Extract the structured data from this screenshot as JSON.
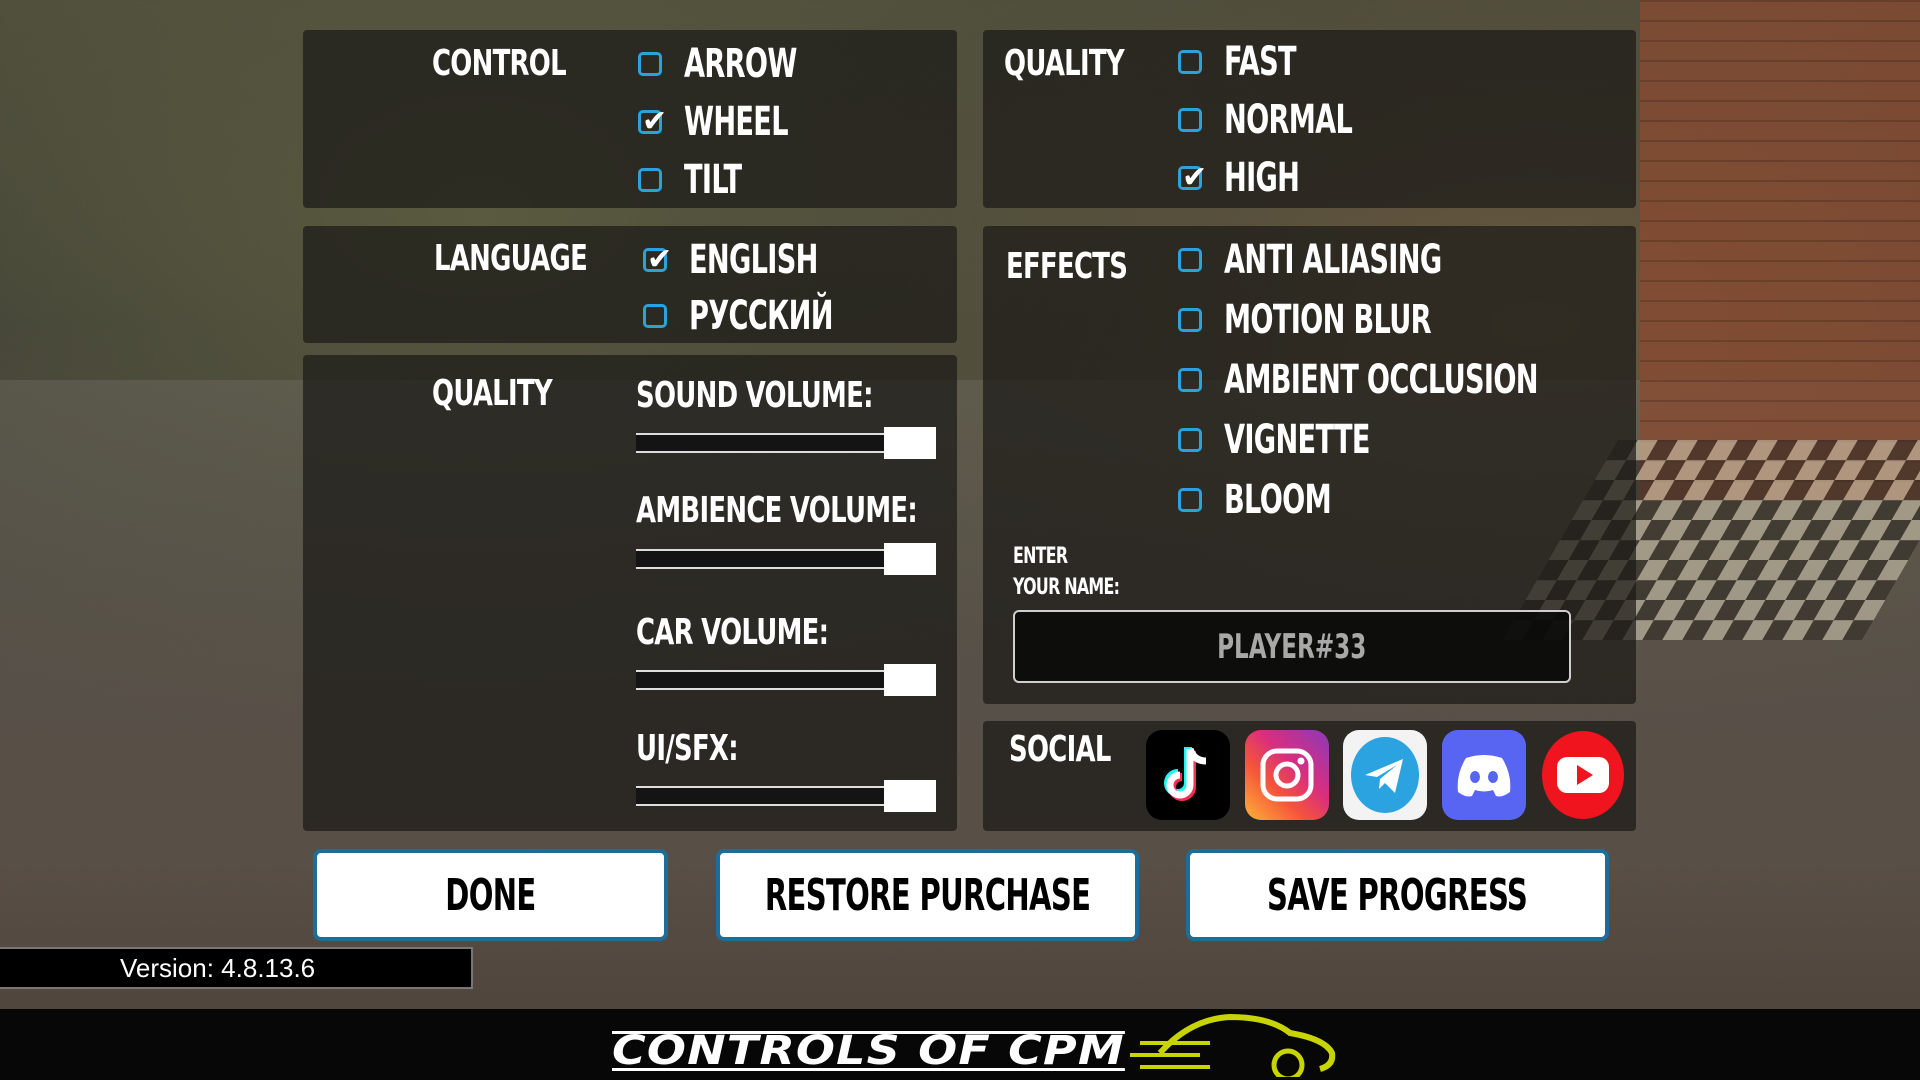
{
  "control": {
    "label": "CONTROL",
    "options": [
      {
        "label": "ARROW",
        "checked": false
      },
      {
        "label": "WHEEL",
        "checked": true
      },
      {
        "label": "TILT",
        "checked": false
      }
    ]
  },
  "language": {
    "label": "LANGUAGE",
    "options": [
      {
        "label": "ENGLISH",
        "checked": true
      },
      {
        "label": "РУССКИЙ",
        "checked": false
      }
    ]
  },
  "audio": {
    "label": "QUALITY",
    "sliders": [
      {
        "label": "SOUND VOLUME:",
        "value": 1.0
      },
      {
        "label": "AMBIENCE VOLUME:",
        "value": 1.0
      },
      {
        "label": "CAR VOLUME:",
        "value": 1.0
      },
      {
        "label": "UI/SFX:",
        "value": 1.0
      }
    ]
  },
  "quality": {
    "label": "QUALITY",
    "options": [
      {
        "label": "FAST",
        "checked": false
      },
      {
        "label": "NORMAL",
        "checked": false
      },
      {
        "label": "HIGH",
        "checked": true
      }
    ]
  },
  "effects": {
    "label": "EFFECTS",
    "options": [
      {
        "label": "ANTI ALIASING",
        "checked": false
      },
      {
        "label": "MOTION BLUR",
        "checked": false
      },
      {
        "label": "AMBIENT OCCLUSION",
        "checked": false
      },
      {
        "label": "VIGNETTE",
        "checked": false
      },
      {
        "label": "BLOOM",
        "checked": false
      }
    ]
  },
  "name_entry": {
    "label_line1": "ENTER",
    "label_line2": "YOUR NAME:",
    "value": "PLAYER#33"
  },
  "social": {
    "label": "SOCIAL",
    "icons": [
      "tiktok-icon",
      "instagram-icon",
      "telegram-icon",
      "discord-icon",
      "youtube-icon"
    ]
  },
  "buttons": {
    "done": "DONE",
    "restore": "RESTORE PURCHASE",
    "save": "SAVE PROGRESS"
  },
  "version": "Version: 4.8.13.6",
  "footer": {
    "title": "CONTROLS OF CPM"
  },
  "colors": {
    "checkbox_accent": "#2aa3dc",
    "button_border": "#1b6d9c",
    "footer_logo_accent": "#c8d400"
  }
}
